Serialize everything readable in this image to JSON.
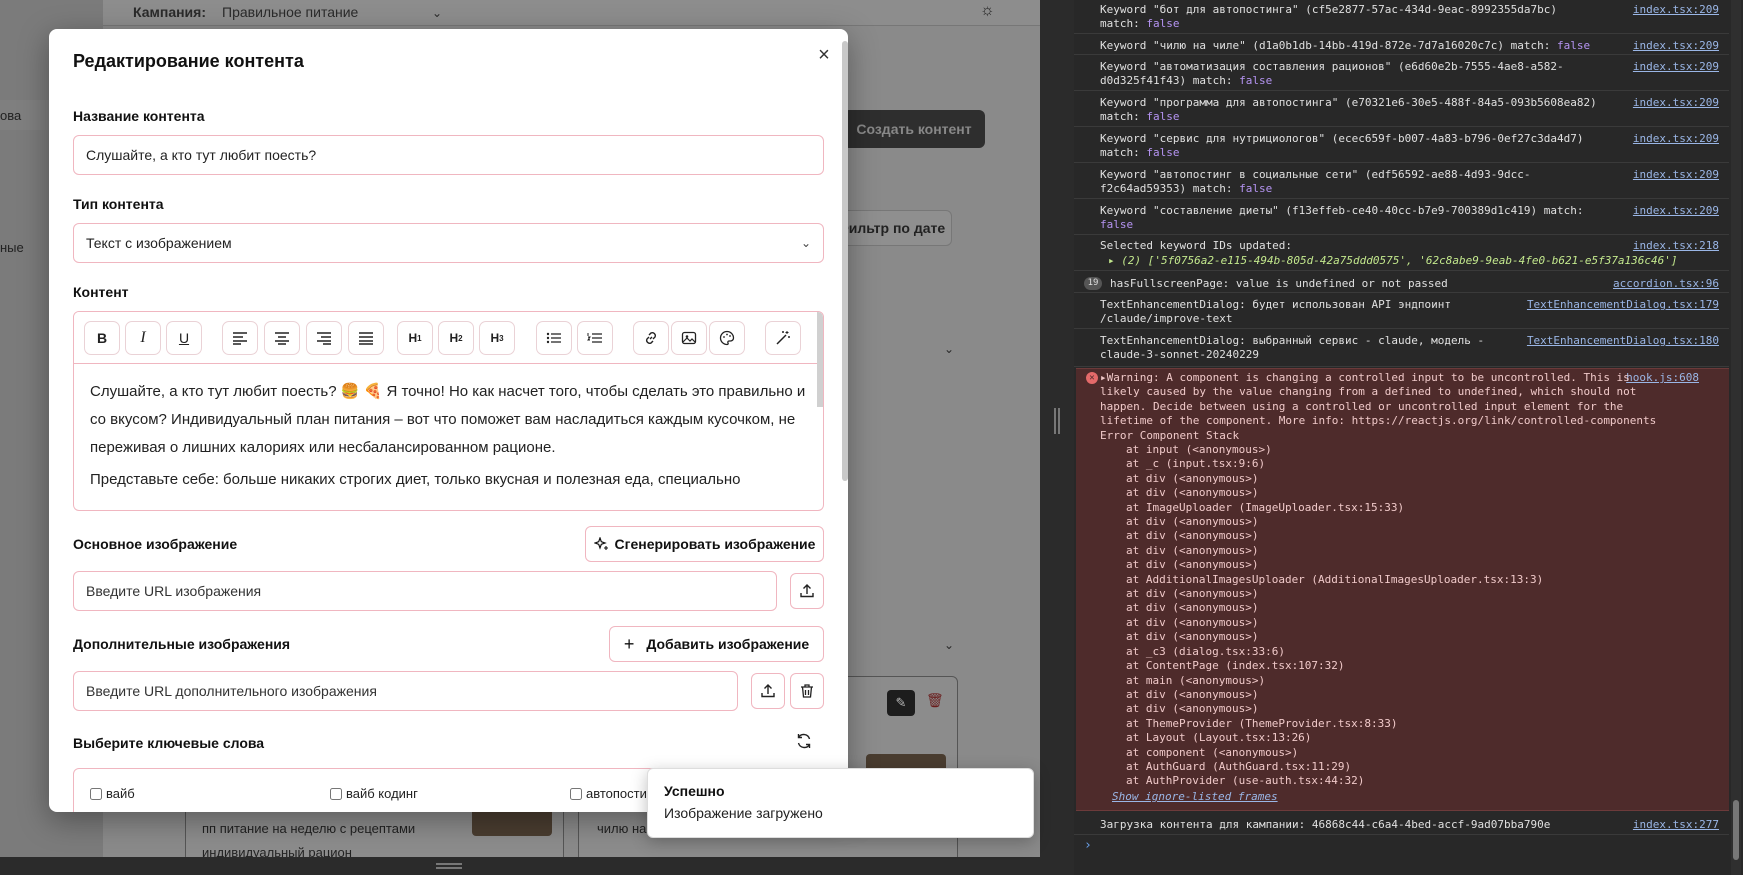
{
  "background": {
    "campaign_label": "Кампания:",
    "campaign_value": "Правильное питание",
    "sidebar_partial_1": "ова",
    "sidebar_partial_2": "ные",
    "create_content_button": "Создать контент",
    "date_filter_button": "Фильтр по дате",
    "card_text_1": "пп питание на неделю с рецептами",
    "card_text_2": "индивидуальный рацион",
    "card_text_3": "чилю на"
  },
  "modal": {
    "title": "Редактирование контента",
    "name_label": "Название контента",
    "name_value": "Слушайте, а кто тут любит поесть?",
    "type_label": "Тип контента",
    "type_value": "Текст с изображением",
    "content_label": "Контент",
    "toolbar": [
      "B",
      "I",
      "U",
      "align-left",
      "align-center",
      "align-right",
      "align-justify",
      "H1",
      "H2",
      "H3",
      "bullet-list",
      "ordered-list",
      "link",
      "image",
      "palette",
      "magic-wand"
    ],
    "content_p1": "Слушайте, а кто тут любит поесть? 🍔 🍕 Я точно! Но как насчет того, чтобы сделать это правильно и со вкусом? Индивидуальный план питания – вот что поможет вам насладиться каждым кусочком, не переживая о лишних калориях или несбалансированном рационе.",
    "content_p2": "Представьте себе: больше никаких строгих диет, только вкусная и полезная еда, специально",
    "main_image_label": "Основное изображение",
    "generate_image_button": "Сгенерировать изображение",
    "main_image_placeholder": "Введите URL изображения",
    "additional_images_label": "Дополнительные изображения",
    "add_image_button": "Добавить изображение",
    "additional_image_placeholder": "Введите URL дополнительного изображения",
    "keywords_label": "Выберите ключевые слова",
    "keywords": [
      "вайб",
      "вайб кодинг",
      "автопости"
    ]
  },
  "toast": {
    "title": "Успешно",
    "message": "Изображение загружено"
  },
  "console": {
    "rows": [
      {
        "msg": "Keyword \"бот для автопостинга\" (cf5e2877-57ac-434d-9eac-8992355da7bc) match:",
        "tail": "false",
        "src": "index.tsx:209"
      },
      {
        "msg": "Keyword \"чилю на чиле\" (d1a0b1db-14bb-419d-872e-7d7a16020c7c) match:",
        "tail": "false",
        "src": "index.tsx:209"
      },
      {
        "msg": "Keyword \"автоматизация составления рационов\" (e6d60e2b-7555-4ae8-a582-d0d325f41f43) match:",
        "tail": "false",
        "src": "index.tsx:209"
      },
      {
        "msg": "Keyword \"программа для автопостинга\" (e70321e6-30e5-488f-84a5-093b5608ea82) match:",
        "tail": "false",
        "src": "index.tsx:209"
      },
      {
        "msg": "Keyword \"сервис для нутрициологов\" (ecec659f-b007-4a83-b796-0ef27c3da4d7) match:",
        "tail": "false",
        "src": "index.tsx:209"
      },
      {
        "msg": "Keyword \"автопостинг в социальные сети\" (edf56592-ae88-4d93-9dcc-f2c64ad59353) match:",
        "tail": "false",
        "src": "index.tsx:209"
      },
      {
        "msg": "Keyword \"составление диеты\" (f13effeb-ce40-40cc-b7e9-700389d1c419) match:",
        "tail": "false",
        "src": "index.tsx:209"
      }
    ],
    "selected_ids_msg": "Selected keyword IDs updated:",
    "selected_ids_src": "index.tsx:218",
    "selected_ids_array": "▸ (2) ['5f0756a2-e115-494b-805d-42a75ddd0575', '62c8abe9-9eab-4fe0-b621-e5f37a136c46']",
    "fullscreen_count": "19",
    "fullscreen_msg": "hasFullscreenPage: value is undefined or not passed",
    "fullscreen_src": "accordion.tsx:96",
    "ted1_msg": "TextEnhancementDialog: будет использован API эндпоинт /claude/improve-text",
    "ted1_src": "TextEnhancementDialog.tsx:179",
    "ted2_msg": "TextEnhancementDialog: выбранный сервис - claude, модель - claude-3-sonnet-20240229",
    "ted2_src": "TextEnhancementDialog.tsx:180",
    "warning_src": "hook.js:608",
    "warning_text": "▸Warning: A component is changing a controlled input to be uncontrolled. This is likely caused by the value changing from a defined to undefined, which should not happen. Decide between using a controlled or uncontrolled input element for the lifetime of the component. More info: https://reactjs.org/link/controlled-components Error Component Stack",
    "stack": [
      "at input (<anonymous>)",
      "at _c (input.tsx:9:6)",
      "at div (<anonymous>)",
      "at div (<anonymous>)",
      "at ImageUploader (ImageUploader.tsx:15:33)",
      "at div (<anonymous>)",
      "at div (<anonymous>)",
      "at div (<anonymous>)",
      "at div (<anonymous>)",
      "at AdditionalImagesUploader (AdditionalImagesUploader.tsx:13:3)",
      "at div (<anonymous>)",
      "at div (<anonymous>)",
      "at div (<anonymous>)",
      "at div (<anonymous>)",
      "at _c3 (dialog.tsx:33:6)",
      "at ContentPage (index.tsx:107:32)",
      "at main (<anonymous>)",
      "at div (<anonymous>)",
      "at div (<anonymous>)",
      "at ThemeProvider (ThemeProvider.tsx:8:33)",
      "at Layout (Layout.tsx:13:26)",
      "at component (<anonymous>)",
      "at AuthGuard (AuthGuard.tsx:11:29)",
      "at AuthProvider (use-auth.tsx:44:32)"
    ],
    "show_ignored": "Show ignore-listed frames",
    "last_msg": "Загрузка контента для кампании: 46868c44-c6a4-4bed-accf-9ad07bba790e",
    "last_src": "index.tsx:277",
    "prompt": "›"
  }
}
